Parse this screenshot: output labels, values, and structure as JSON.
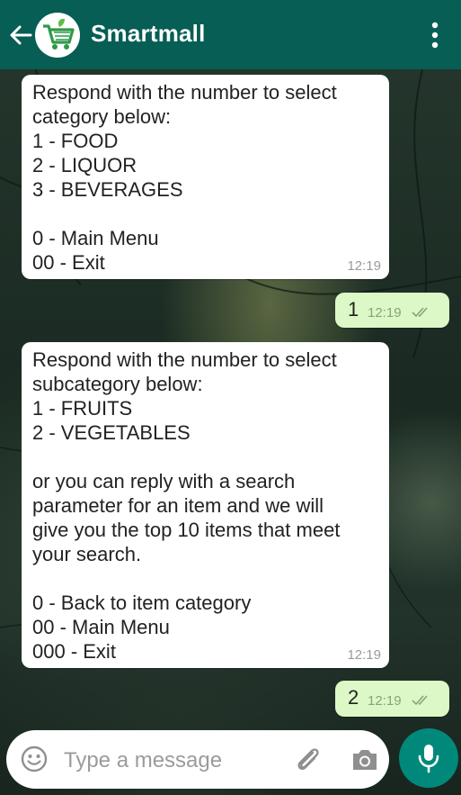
{
  "header": {
    "title": "Smartmall",
    "icons": {
      "back": "arrow-left-icon",
      "avatar": "shopping-cart-logo",
      "menu": "more-vert-icon"
    },
    "color": "#075e54"
  },
  "messages": [
    {
      "direction": "in",
      "text": "Respond with the number to select\ncategory below:\n1 - FOOD\n2 - LIQUOR\n3 - BEVERAGES\n\n0 - Main Menu\n00 - Exit",
      "time": "12:19"
    },
    {
      "direction": "out",
      "text": "1",
      "time": "12:19",
      "status": "read-double-check"
    },
    {
      "direction": "in",
      "text": "Respond with the number to select\nsubcategory below:\n1 - FRUITS\n2 - VEGETABLES\n\nor you can reply with a search\nparameter for an item and we will\ngive you the top 10 items that meet\nyour search.\n\n0 - Back to item category\n00 - Main Menu\n000 - Exit",
      "time": "12:19"
    },
    {
      "direction": "out",
      "text": "2",
      "time": "12:19",
      "status": "read-double-check"
    }
  ],
  "composer": {
    "placeholder": "Type a message",
    "icons": [
      "emoji-icon",
      "attach-icon",
      "camera-icon",
      "mic-icon"
    ]
  },
  "colors": {
    "incoming_bubble": "#ffffff",
    "outgoing_bubble": "#dcf8c6",
    "accent": "#00897b"
  }
}
